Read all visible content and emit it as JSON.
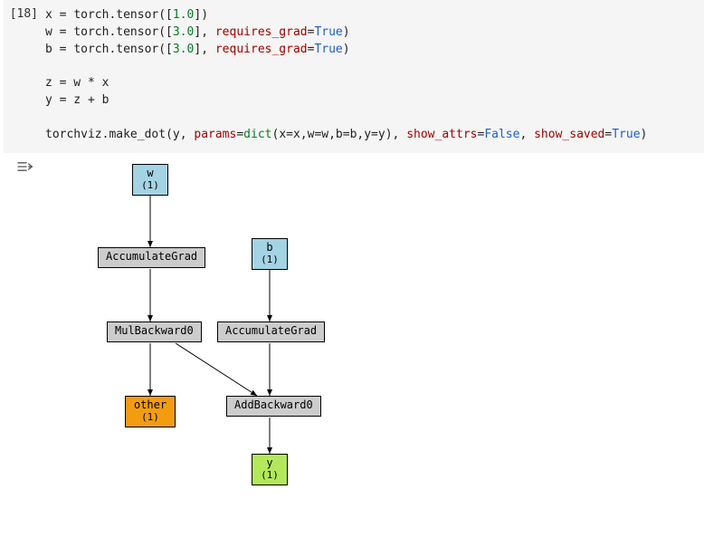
{
  "cell": {
    "prompt": "[18]",
    "code": {
      "l1_var": "x",
      "l1_tensor": "torch.tensor",
      "l1_val": "1.0",
      "l2_var": "w",
      "l2_val": "3.0",
      "l2_kw": "requires_grad",
      "l2_bool": "True",
      "l3_var": "b",
      "l3_val": "3.0",
      "l3_kw": "requires_grad",
      "l3_bool": "True",
      "l5": "z = w * x",
      "l6": "y = z + b",
      "l8_call": "torchviz.make_dot",
      "l8_y": "y",
      "l8_params": "params",
      "l8_dict": "dict",
      "l8_args": "x=x,w=w,b=b,y=y",
      "l8_show_attrs": "show_attrs",
      "l8_false": "False",
      "l8_show_saved": "show_saved",
      "l8_true": "True"
    }
  },
  "graph": {
    "nodes": {
      "w": {
        "label": "w",
        "shape": "(1)"
      },
      "acc_w": {
        "label": "AccumulateGrad"
      },
      "b": {
        "label": "b",
        "shape": "(1)"
      },
      "acc_b": {
        "label": "AccumulateGrad"
      },
      "mul": {
        "label": "MulBackward0"
      },
      "other": {
        "label": "other",
        "shape": "(1)"
      },
      "add": {
        "label": "AddBackward0"
      },
      "y": {
        "label": "y",
        "shape": "(1)"
      }
    }
  }
}
